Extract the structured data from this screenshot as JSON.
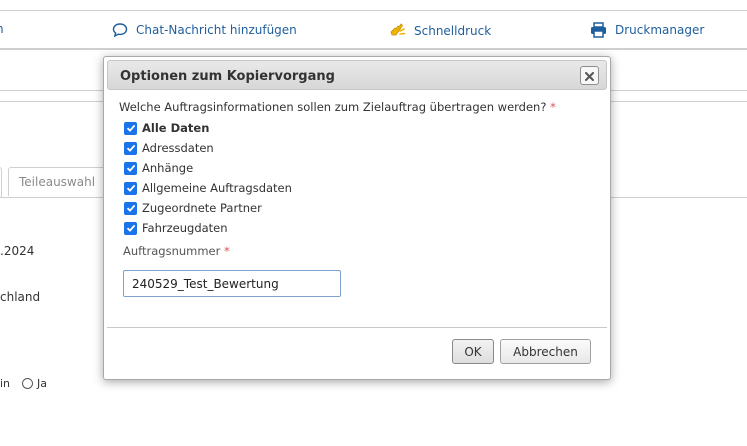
{
  "toolbar": {
    "items": [
      {
        "label": "n",
        "icon": "partial-icon"
      },
      {
        "label": "Chat-Nachricht hinzufügen",
        "icon": "chat-bubble-icon"
      },
      {
        "label": "Schnelldruck",
        "icon": "quick-print-hand-icon"
      },
      {
        "label": "Druckmanager",
        "icon": "printer-icon"
      }
    ]
  },
  "tabs": {
    "partial_tab": "Teileauswahl"
  },
  "background": {
    "date_fragment": ".2024",
    "country_fragment": "chland",
    "radio_prefix": "in",
    "radio_label": "Ja"
  },
  "dialog": {
    "title": "Optionen zum Kopiervorgang",
    "close_icon": "close-x-icon",
    "question": "Welche Auftragsinformationen sollen zum Zielauftrag übertragen werden?",
    "required_mark": "*",
    "options": [
      {
        "label": "Alle Daten",
        "checked": true,
        "bold": true
      },
      {
        "label": "Adressdaten",
        "checked": true
      },
      {
        "label": "Anhänge",
        "checked": true
      },
      {
        "label": "Allgemeine Auftragsdaten",
        "checked": true
      },
      {
        "label": "Zugeordnete Partner",
        "checked": true
      },
      {
        "label": "Fahrzeugdaten",
        "checked": true
      }
    ],
    "order_number_label": "Auftragsnummer",
    "order_number_value": "240529_Test_Bewertung",
    "ok_label": "OK",
    "cancel_label": "Abbrechen"
  },
  "colors": {
    "link": "#1f5e9c",
    "checkbox": "#1a73e8",
    "required": "#d9534f",
    "quick_print_icon": "#f0b400"
  }
}
